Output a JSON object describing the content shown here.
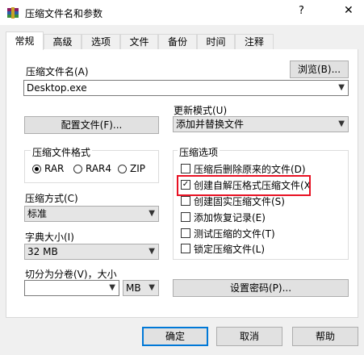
{
  "window": {
    "title": "压缩文件名和参数",
    "help_glyph": "?",
    "close_glyph": "✕"
  },
  "tabs": [
    "常规",
    "高级",
    "选项",
    "文件",
    "备份",
    "时间",
    "注释"
  ],
  "archive": {
    "label": "压缩文件名(A)",
    "value": "Desktop.exe",
    "browse_label": "浏览(B)..."
  },
  "update_mode": {
    "label": "更新模式(U)",
    "value": "添加并替换文件"
  },
  "config_button": "配置文件(F)...",
  "format": {
    "label": "压缩文件格式",
    "options": [
      "RAR",
      "RAR4",
      "ZIP"
    ],
    "selected": "RAR"
  },
  "options_group": {
    "label": "压缩选项",
    "items": [
      {
        "label": "压缩后删除原来的文件(D)",
        "checked": false
      },
      {
        "label": "创建自解压格式压缩文件(X",
        "checked": true
      },
      {
        "label": "创建固实压缩文件(S)",
        "checked": false
      },
      {
        "label": "添加恢复记录(E)",
        "checked": false
      },
      {
        "label": "测试压缩的文件(T)",
        "checked": false
      },
      {
        "label": "锁定压缩文件(L)",
        "checked": false
      }
    ]
  },
  "method": {
    "label": "压缩方式(C)",
    "value": "标准"
  },
  "dictionary": {
    "label": "字典大小(I)",
    "value": "32 MB"
  },
  "split": {
    "label": "切分为分卷(V)，大小",
    "value": "",
    "unit": "MB"
  },
  "password_button": "设置密码(P)...",
  "footer": {
    "ok": "确定",
    "cancel": "取消",
    "help": "帮助"
  },
  "colors": {
    "highlight": "#e81123",
    "accent": "#0078d7"
  }
}
